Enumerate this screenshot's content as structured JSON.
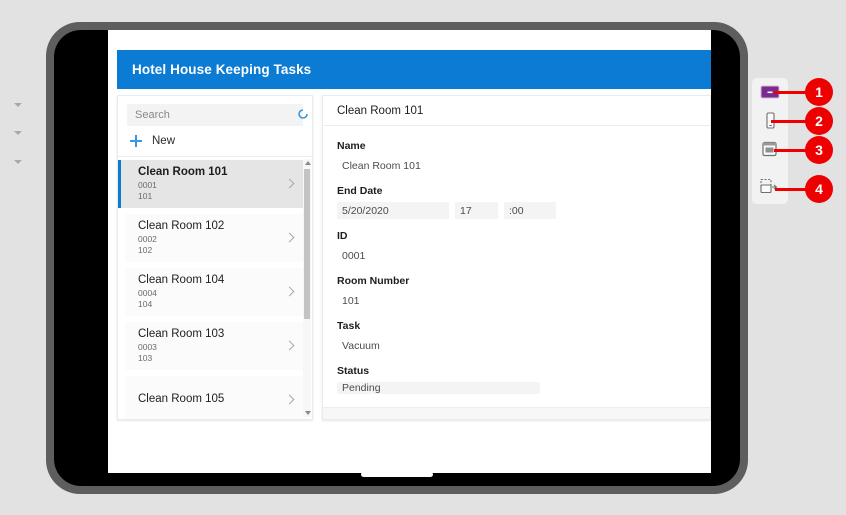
{
  "app": {
    "header_title": "Hotel House Keeping Tasks"
  },
  "list_panel": {
    "search_placeholder": "Search",
    "refresh_icon": "refresh-icon",
    "new_label": "New",
    "new_icon": "plus-icon",
    "items": [
      {
        "title": "Clean Room 101",
        "id": "0001",
        "room": "101",
        "selected": true
      },
      {
        "title": "Clean Room 102",
        "id": "0002",
        "room": "102",
        "selected": false
      },
      {
        "title": "Clean Room 104",
        "id": "0004",
        "room": "104",
        "selected": false
      },
      {
        "title": "Clean Room 103",
        "id": "0003",
        "room": "103",
        "selected": false
      },
      {
        "title": "Clean Room 105",
        "id": "",
        "room": "",
        "selected": false
      }
    ]
  },
  "detail_panel": {
    "title": "Clean Room 101",
    "fields": {
      "name_label": "Name",
      "name_value": "Clean Room 101",
      "end_date_label": "End Date",
      "end_date_value": "5/20/2020",
      "end_hour_value": "17",
      "end_minute_value": ":00",
      "id_label": "ID",
      "id_value": "0001",
      "room_number_label": "Room Number",
      "room_number_value": "101",
      "task_label": "Task",
      "task_value": "Vacuum",
      "status_label": "Status",
      "status_value": "Pending"
    }
  },
  "callouts": [
    {
      "number": "1",
      "icon": "desktop-monitor-icon",
      "color": "#7b2a8e"
    },
    {
      "number": "2",
      "icon": "mobile-phone-icon",
      "color": "#6e6e6e"
    },
    {
      "number": "3",
      "icon": "tablet-device-icon",
      "color": "#6e6e6e"
    },
    {
      "number": "4",
      "icon": "custom-size-icon",
      "color": "#6e6e6e"
    }
  ],
  "colors": {
    "header_blue": "#0b7bd4",
    "accent_blue": "#0b7bd4",
    "badge_red": "#ee0000",
    "device_bezel": "#5e5e5e",
    "page_background": "#e2e2e2"
  }
}
